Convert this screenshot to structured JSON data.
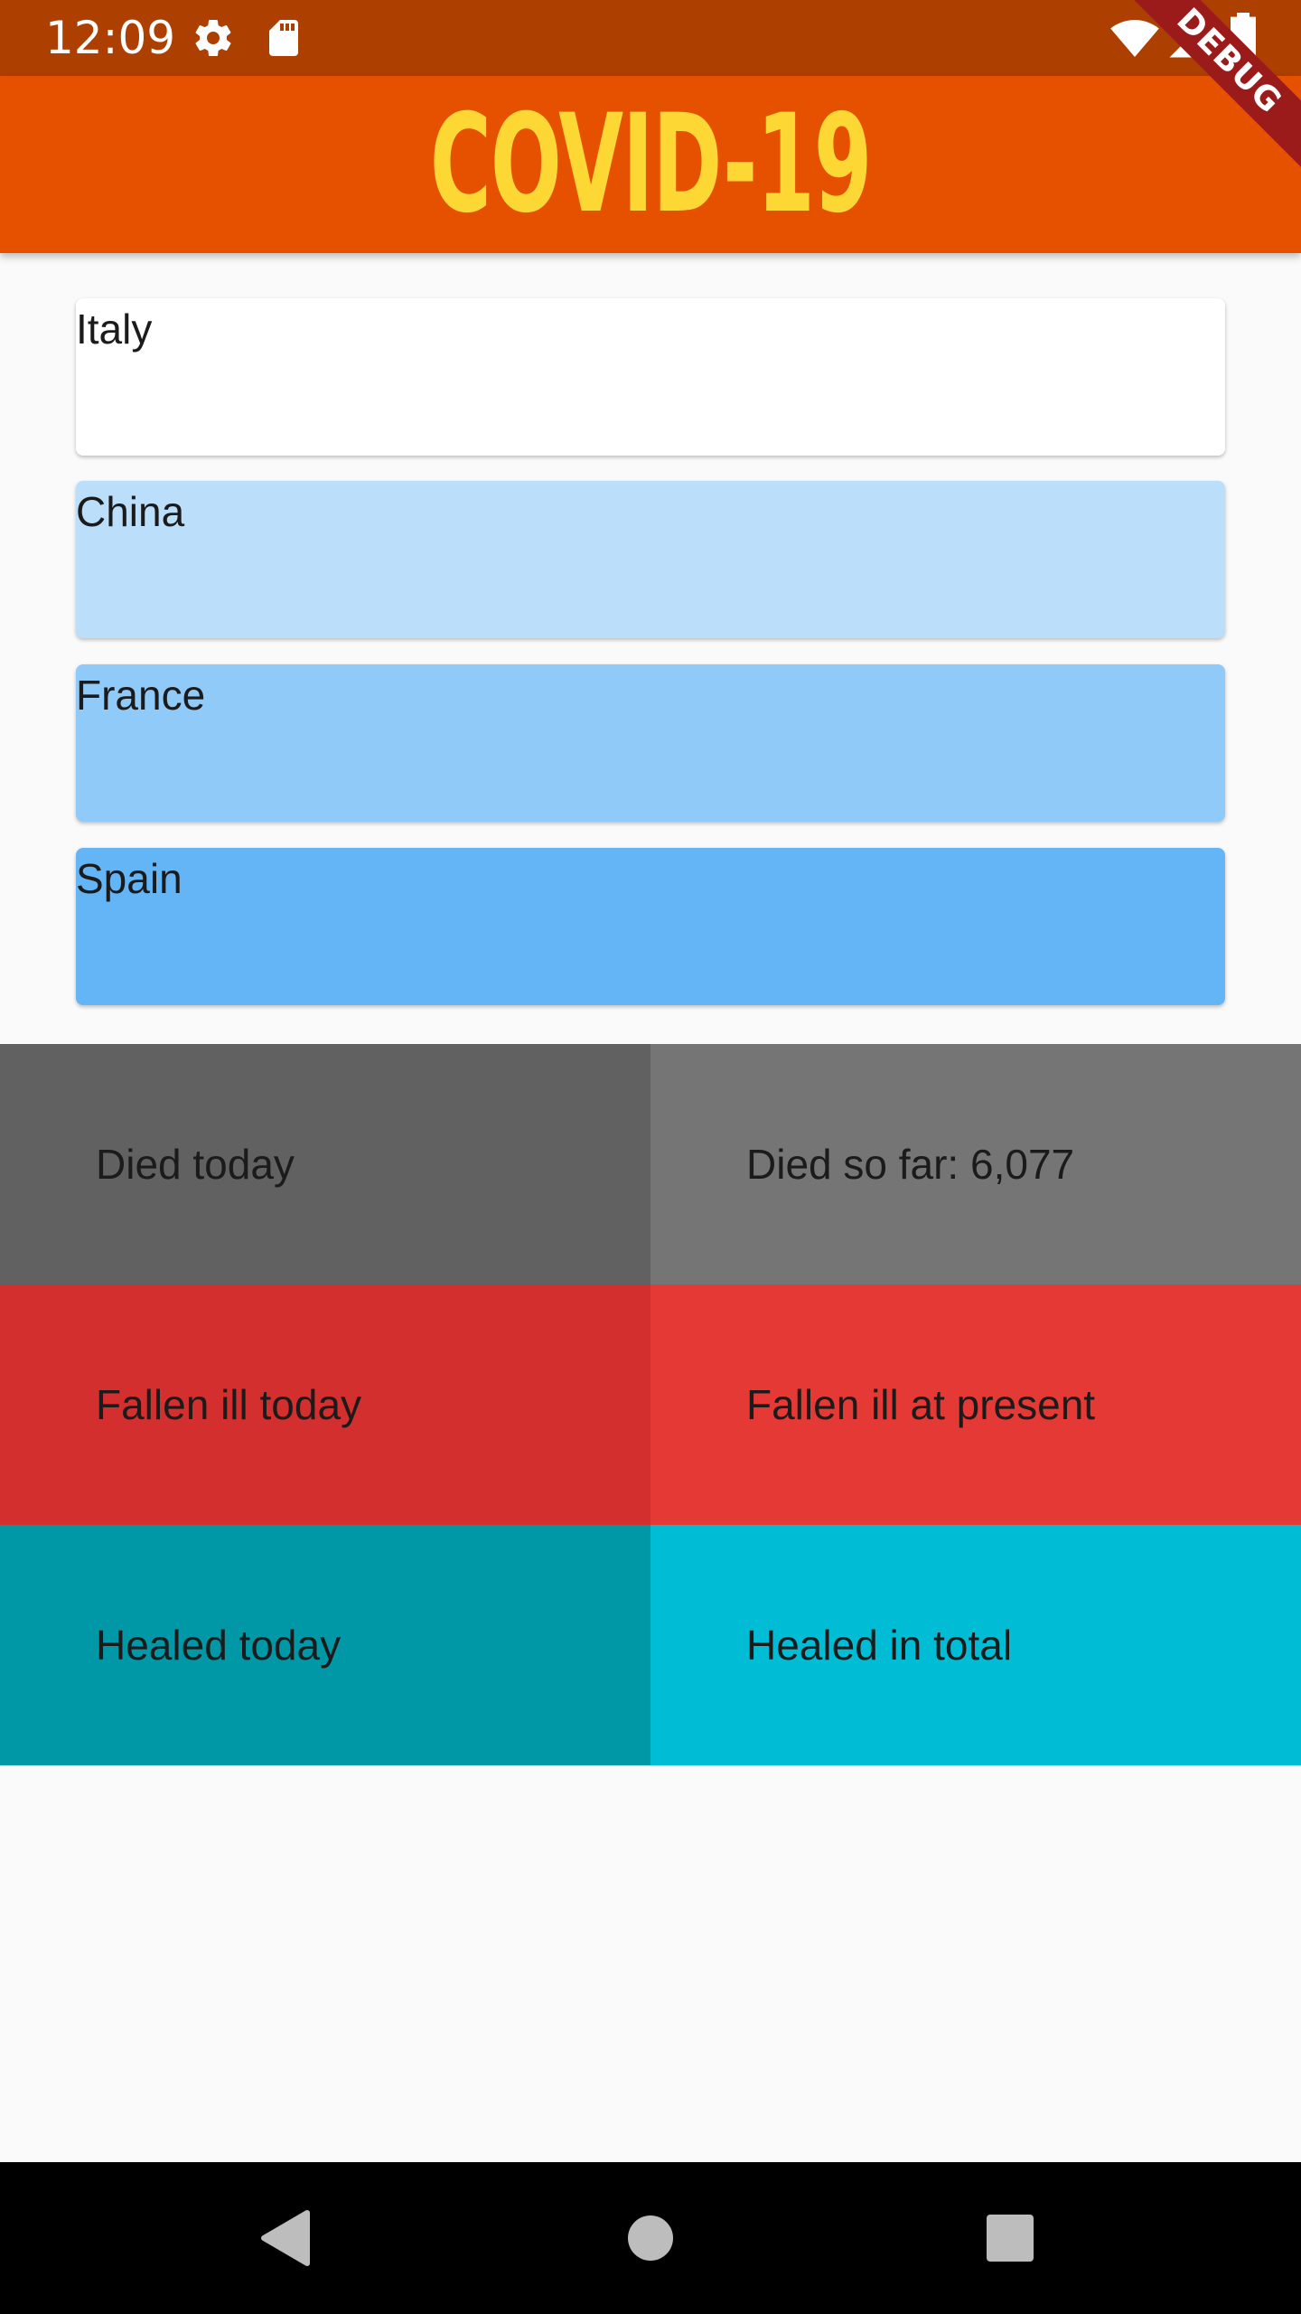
{
  "status_bar": {
    "time": "12:09",
    "left_icons": [
      "gear-icon",
      "sd-card-icon"
    ],
    "right_icons": [
      "wifi-icon",
      "signal-icon",
      "battery-icon"
    ],
    "background": "#ad3f00"
  },
  "debug_banner": "DEBUG",
  "app_bar": {
    "title": "COVID-19",
    "background": "#e65100",
    "title_color": "#fdd835"
  },
  "countries": [
    {
      "label": "Italy",
      "color": "#ffffff"
    },
    {
      "label": "China",
      "color": "#bbdefb"
    },
    {
      "label": "France",
      "color": "#90caf9"
    },
    {
      "label": "Spain",
      "color": "#64b5f6"
    }
  ],
  "stats": {
    "died_today": {
      "label": "Died today",
      "color": "#616161"
    },
    "died_so_far": {
      "label": "Died so far: 6,077",
      "color": "#757575"
    },
    "fallen_ill_today": {
      "label": "Fallen ill today",
      "color": "#d32f2f"
    },
    "fallen_ill_present": {
      "label": "Fallen ill at present",
      "color": "#e53935"
    },
    "healed_today": {
      "label": "Healed today",
      "color": "#0097a7"
    },
    "healed_total": {
      "label": "Healed in total",
      "color": "#00bcd4"
    }
  },
  "nav_bar": {
    "buttons": [
      "back-icon",
      "home-icon",
      "recents-icon"
    ]
  }
}
